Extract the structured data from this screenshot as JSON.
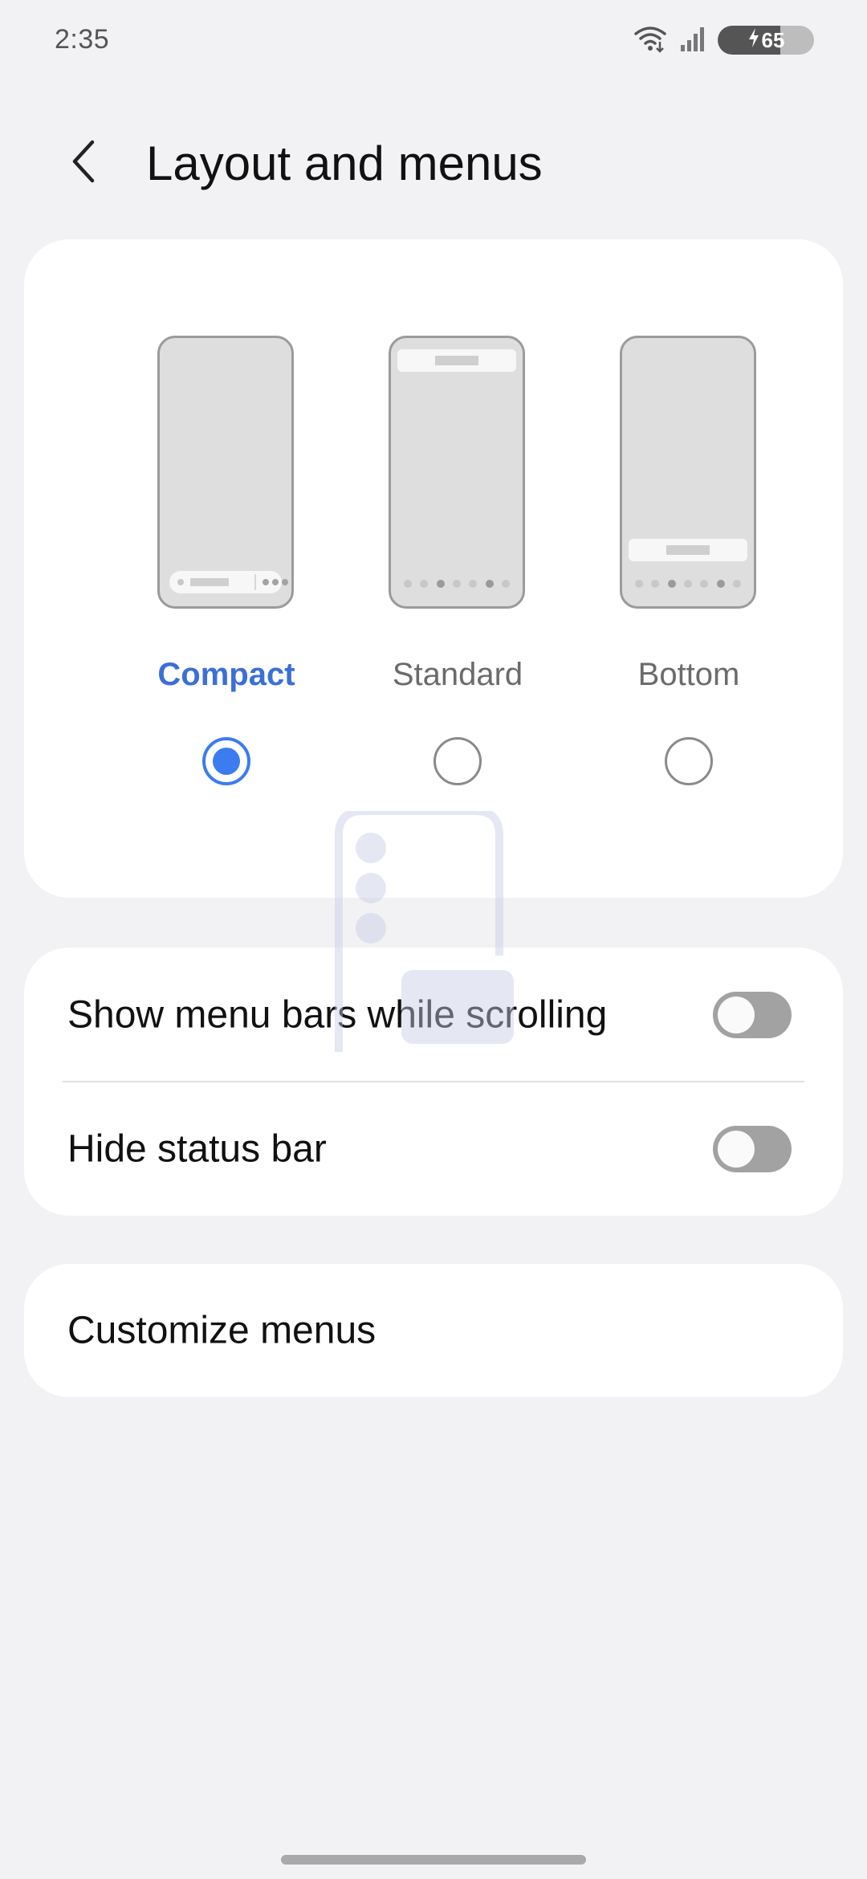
{
  "status_bar": {
    "time": "2:35",
    "battery_percent": 65,
    "battery_label": "65",
    "icons": [
      "wifi-icon",
      "signal-icon",
      "battery-icon",
      "charging-bolt-icon"
    ]
  },
  "header": {
    "title": "Layout and menus",
    "back_icon": "back-arrow-icon"
  },
  "layout_options": {
    "selected": "compact",
    "items": [
      {
        "id": "compact",
        "label": "Compact",
        "selected": true
      },
      {
        "id": "standard",
        "label": "Standard",
        "selected": false
      },
      {
        "id": "bottom",
        "label": "Bottom",
        "selected": false
      }
    ]
  },
  "settings": {
    "show_menu_bars": {
      "label": "Show menu bars while scrolling",
      "enabled": false
    },
    "hide_status_bar": {
      "label": "Hide status bar",
      "enabled": false
    }
  },
  "customize": {
    "label": "Customize menus"
  },
  "colors": {
    "accent": "#3b7cf0",
    "selected_label": "#3b6fd8",
    "background": "#f2f2f4",
    "card": "#ffffff",
    "toggle_off": "#a2a2a2"
  }
}
